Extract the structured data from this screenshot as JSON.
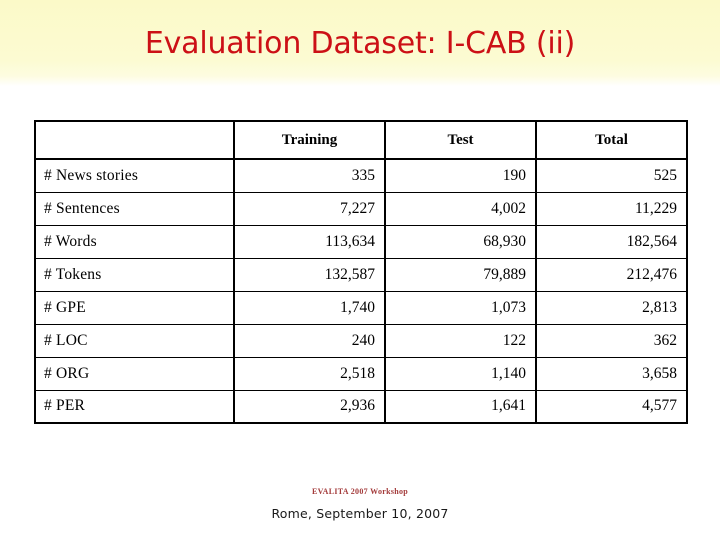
{
  "slide": {
    "title": "Evaluation Dataset: I-CAB (ii)",
    "title_color": "#cc1016",
    "band_color": "#fcfbd2",
    "background_color": "#ffffff"
  },
  "table": {
    "columns": [
      "",
      "Training",
      "Test",
      "Total"
    ],
    "rows": [
      {
        "label": "# News stories",
        "training": "335",
        "test": "190",
        "total": "525"
      },
      {
        "label": "# Sentences",
        "training": "7,227",
        "test": "4,002",
        "total": "11,229"
      },
      {
        "label": "# Words",
        "training": "113,634",
        "test": "68,930",
        "total": "182,564"
      },
      {
        "label": "# Tokens",
        "training": "132,587",
        "test": "79,889",
        "total": "212,476"
      },
      {
        "label": "# GPE",
        "training": "1,740",
        "test": "1,073",
        "total": "2,813"
      },
      {
        "label": "# LOC",
        "training": "240",
        "test": "122",
        "total": "362"
      },
      {
        "label": "# ORG",
        "training": "2,518",
        "test": "1,140",
        "total": "3,658"
      },
      {
        "label": "# PER",
        "training": "2,936",
        "test": "1,641",
        "total": "4,577"
      }
    ]
  },
  "footer": {
    "workshop": "EVALITA 2007 Workshop",
    "place_date": "Rome, September 10, 2007",
    "workshop_color": "#a33a3a"
  }
}
